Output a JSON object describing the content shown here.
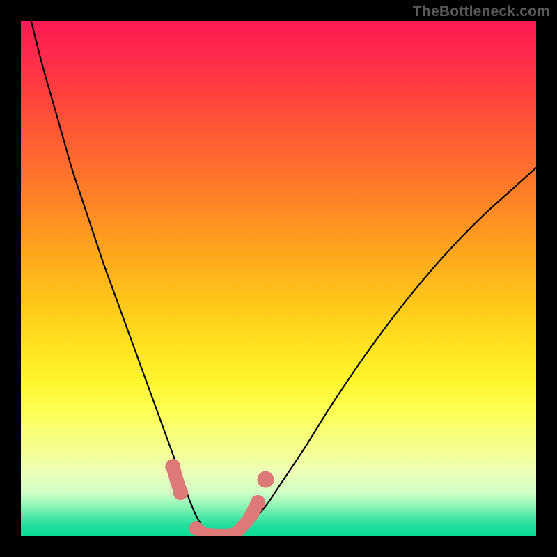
{
  "watermark": "TheBottleneck.com",
  "chart_data": {
    "type": "line",
    "title": "",
    "xlabel": "",
    "ylabel": "",
    "xlim": [
      0,
      100
    ],
    "ylim": [
      0,
      100
    ],
    "grid": false,
    "legend": false,
    "x": [
      0,
      2,
      4,
      6,
      8,
      10,
      12,
      14,
      16,
      18,
      20,
      22,
      24,
      26,
      28,
      30,
      32,
      33,
      34,
      35,
      36,
      38,
      40,
      42,
      44,
      46,
      48,
      50,
      55,
      60,
      65,
      70,
      75,
      80,
      85,
      90,
      95,
      100
    ],
    "series": [
      {
        "name": "bottleneck-curve",
        "color": "#000000",
        "values": [
          null,
          100,
          92,
          85,
          78,
          71,
          65,
          59,
          53,
          47.5,
          42,
          36.5,
          31,
          25.5,
          20,
          14.5,
          9,
          6.3,
          4,
          2.2,
          1,
          0.3,
          0,
          0.5,
          2,
          4,
          6.5,
          9.5,
          17,
          25,
          32.5,
          39.5,
          46,
          52,
          57.5,
          62.5,
          67,
          71.5
        ]
      }
    ],
    "markers": {
      "name": "highlighted-points",
      "color": "#dd7a78",
      "points": [
        {
          "x": 29.5,
          "y": 13.5
        },
        {
          "x": 30.2,
          "y": 11
        },
        {
          "x": 31,
          "y": 8.5
        },
        {
          "x": 34,
          "y": 1.5
        },
        {
          "x": 35.5,
          "y": 0.5
        },
        {
          "x": 37,
          "y": 0.2
        },
        {
          "x": 38.5,
          "y": 0.15
        },
        {
          "x": 40,
          "y": 0.15
        },
        {
          "x": 41,
          "y": 0.3
        },
        {
          "x": 41.8,
          "y": 0.7
        },
        {
          "x": 42.6,
          "y": 1.4
        },
        {
          "x": 43.3,
          "y": 2.2
        },
        {
          "x": 44,
          "y": 3
        },
        {
          "x": 44.7,
          "y": 4
        },
        {
          "x": 46,
          "y": 6.5
        },
        {
          "x": 47.5,
          "y": 11
        }
      ]
    },
    "annotations": [],
    "background_gradient": {
      "top": "#ff1a53",
      "middle": "#ffe221",
      "bottom": "#07d995"
    }
  }
}
